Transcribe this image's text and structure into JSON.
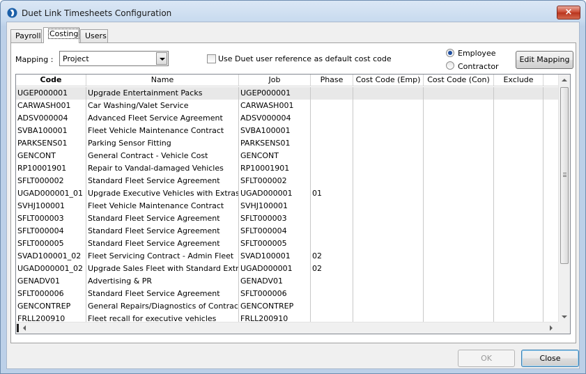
{
  "window": {
    "title": "Duet Link Timesheets Configuration",
    "close_glyph": "×"
  },
  "tabs": [
    {
      "label": "Payroll"
    },
    {
      "label": "Costing"
    },
    {
      "label": "Users"
    }
  ],
  "mapping": {
    "label": "Mapping :",
    "value": "Project"
  },
  "use_duet_ref": {
    "label": "Use Duet user reference as default cost code",
    "checked": false
  },
  "radios": {
    "employee": "Employee",
    "contractor": "Contractor",
    "selected": "Employee"
  },
  "edit_mapping_label": "Edit Mapping",
  "grid": {
    "columns": [
      "Code",
      "Name",
      "Job",
      "Phase",
      "Cost Code (Emp)",
      "Cost Code (Con)",
      "Exclude",
      ""
    ],
    "rows": [
      [
        "UGEP000001",
        "Upgrade Entertainment Packs",
        "UGEP000001",
        "",
        "",
        "",
        "",
        ""
      ],
      [
        "CARWASH001",
        "Car Washing/Valet Service",
        "CARWASH001",
        "",
        "",
        "",
        "",
        ""
      ],
      [
        "ADSV000004",
        "Advanced Fleet Service Agreement",
        "ADSV000004",
        "",
        "",
        "",
        "",
        ""
      ],
      [
        "SVBA100001",
        "Fleet Vehicle Maintenance Contract",
        "SVBA100001",
        "",
        "",
        "",
        "",
        ""
      ],
      [
        "PARKSENS01",
        "Parking Sensor Fitting",
        "PARKSENS01",
        "",
        "",
        "",
        "",
        ""
      ],
      [
        "GENCONT",
        "General Contract - Vehicle Cost",
        "GENCONT",
        "",
        "",
        "",
        "",
        ""
      ],
      [
        "RP10001901",
        "Repair to Vandal-damaged Vehicles",
        "RP10001901",
        "",
        "",
        "",
        "",
        ""
      ],
      [
        "SFLT000002",
        "Standard Fleet Service Agreement",
        "SFLT000002",
        "",
        "",
        "",
        "",
        ""
      ],
      [
        "UGAD000001_01",
        "Upgrade Executive Vehicles with Extras",
        "UGAD000001",
        "01",
        "",
        "",
        "",
        ""
      ],
      [
        "SVHJ100001",
        "Fleet Vehicle Maintenance Contract",
        "SVHJ100001",
        "",
        "",
        "",
        "",
        ""
      ],
      [
        "SFLT000003",
        "Standard Fleet Service Agreement",
        "SFLT000003",
        "",
        "",
        "",
        "",
        ""
      ],
      [
        "SFLT000004",
        "Standard Fleet Service Agreement",
        "SFLT000004",
        "",
        "",
        "",
        "",
        ""
      ],
      [
        "SFLT000005",
        "Standard Fleet Service Agreement",
        "SFLT000005",
        "",
        "",
        "",
        "",
        ""
      ],
      [
        "SVAD100001_02",
        "Fleet Servicing Contract - Admin Fleet",
        "SVAD100001",
        "02",
        "",
        "",
        "",
        ""
      ],
      [
        "UGAD000001_02",
        "Upgrade Sales Fleet with Standard Extras",
        "UGAD000001",
        "02",
        "",
        "",
        "",
        ""
      ],
      [
        "GENADV01",
        "Advertising & PR",
        "GENADV01",
        "",
        "",
        "",
        "",
        ""
      ],
      [
        "SFLT000006",
        "Standard Fleet Service Agreement",
        "SFLT000006",
        "",
        "",
        "",
        "",
        ""
      ],
      [
        "GENCONTREP",
        "General Repairs/Diagnostics of Contract",
        "GENCONTREP",
        "",
        "",
        "",
        "",
        ""
      ],
      [
        "FRLL200910",
        "Fleet recall for executive vehicles",
        "FRLL200910",
        "",
        "",
        "",
        "",
        ""
      ]
    ],
    "selected_row": 0
  },
  "footer": {
    "ok_label": "OK",
    "close_label": "Close"
  }
}
